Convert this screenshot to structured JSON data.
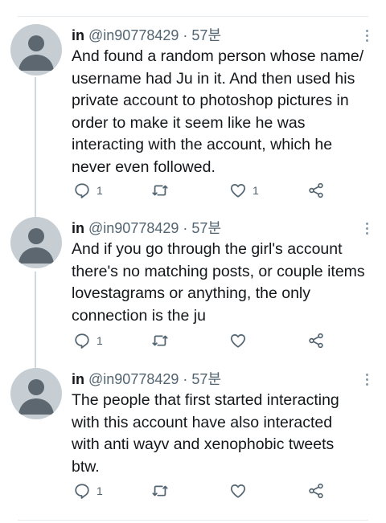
{
  "tweets": [
    {
      "name": "in",
      "handle": "@in90778429",
      "separator": "·",
      "time": "57분",
      "text": "And found a random person whose name/\nusername had Ju in it. And then used his\nprivate account to photoshop pictures in\norder to make it seem like he was\ninteracting with the account, which he\nnever even followed.",
      "reply_count": "1",
      "retweet_count": "",
      "like_count": "1"
    },
    {
      "name": "in",
      "handle": "@in90778429",
      "separator": "·",
      "time": "57분",
      "text": "And if you go through the girl's account\nthere's no matching posts, or couple items\nlovestagrams or anything, the only\nconnection is the ju",
      "reply_count": "1",
      "retweet_count": "",
      "like_count": ""
    },
    {
      "name": "in",
      "handle": "@in90778429",
      "separator": "·",
      "time": "57분",
      "text": "The people that first started interacting\nwith this account have also interacted\nwith anti wayv and xenophobic tweets\nbtw.",
      "reply_count": "1",
      "retweet_count": "",
      "like_count": ""
    }
  ],
  "icons": {
    "reply": "reply-icon",
    "retweet": "retweet-icon",
    "like": "heart-icon",
    "share": "share-icon",
    "more": "more-options-icon"
  },
  "colors": {
    "text": "#14171a",
    "secondary": "#536471",
    "icon": "#536471",
    "avatar_bg": "#c6ced4",
    "avatar_fg": "#5c6770",
    "thread_line": "#cfd9de"
  }
}
